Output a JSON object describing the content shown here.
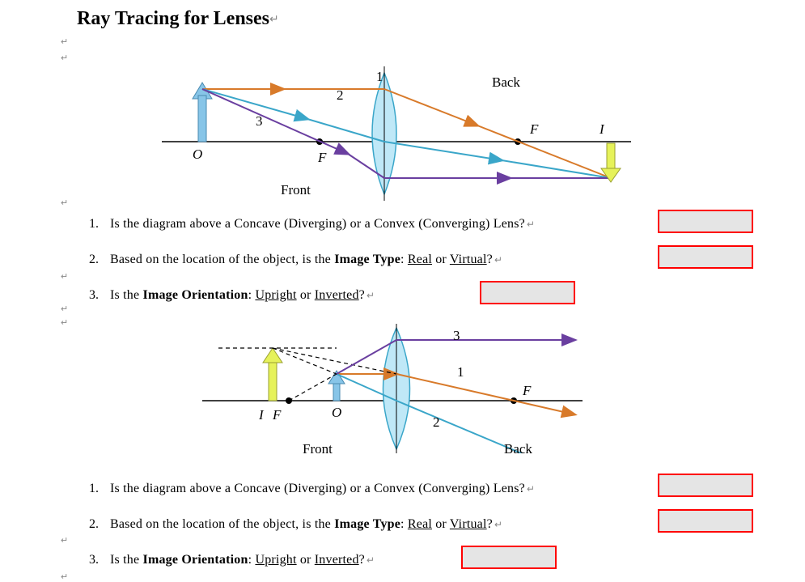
{
  "title": "Ray Tracing for Lenses",
  "marker": "↵",
  "diagram1": {
    "front_label": "Front",
    "back_label": "Back",
    "O": "O",
    "F": "F",
    "I": "I",
    "r1": "1",
    "r2": "2",
    "r3": "3"
  },
  "diagram2": {
    "front_label": "Front",
    "back_label": "Back",
    "O": "O",
    "F": "F",
    "I": "I",
    "r1": "1",
    "r2": "2",
    "r3": "3"
  },
  "set1": {
    "q1": {
      "num": "1.",
      "pre": "Is the diagram above a Concave (Diverging) or a Convex (Converging) Lens?"
    },
    "q2": {
      "num": "2.",
      "pre": "Based on the location of the object, is the ",
      "bold": "Image Type",
      "mid": ":  ",
      "opt1": "Real",
      "sep": " or ",
      "opt2": "Virtual",
      "end": "?"
    },
    "q3": {
      "num": "3.",
      "pre": "Is the ",
      "bold": "Image Orientation",
      "mid": ":  ",
      "opt1": "Upright",
      "sep": " or ",
      "opt2": "Inverted",
      "end": "?"
    }
  },
  "set2": {
    "q1": {
      "num": "1.",
      "pre": "Is the diagram above a Concave (Diverging) or a Convex (Converging) Lens?"
    },
    "q2": {
      "num": "2.",
      "pre": "Based on the location of the object, is the ",
      "bold": "Image Type",
      "mid": ":  ",
      "opt1": "Real",
      "sep": " or ",
      "opt2": "Virtual",
      "end": "?"
    },
    "q3": {
      "num": "3.",
      "pre": "Is the ",
      "bold": "Image Orientation",
      "mid": ":  ",
      "opt1": "Upright",
      "sep": " or ",
      "opt2": "Inverted",
      "end": "?"
    }
  }
}
